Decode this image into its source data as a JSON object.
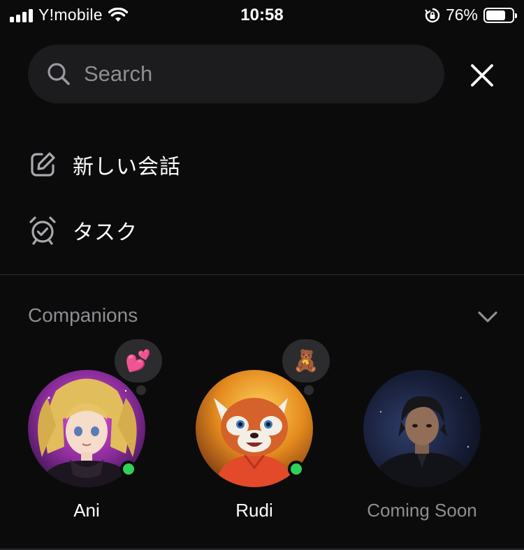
{
  "status_bar": {
    "carrier": "Y!mobile",
    "time": "10:58",
    "battery_percent": "76%",
    "battery_level": 0.76
  },
  "search": {
    "placeholder": "Search"
  },
  "menu": {
    "items": [
      {
        "label": "新しい会話",
        "icon": "compose-icon"
      },
      {
        "label": "タスク",
        "icon": "alarm-clock-icon"
      }
    ]
  },
  "companions": {
    "title": "Companions",
    "items": [
      {
        "name": "Ani",
        "status_emoji": "💕",
        "online": true
      },
      {
        "name": "Rudi",
        "status_emoji": "🧸",
        "online": true
      },
      {
        "name": "Coming Soon",
        "online": false
      }
    ]
  },
  "colors": {
    "background": "#0b0b0c",
    "search_bg": "#1c1c1e",
    "muted_text": "#8e8e93",
    "online_green": "#30d158"
  }
}
